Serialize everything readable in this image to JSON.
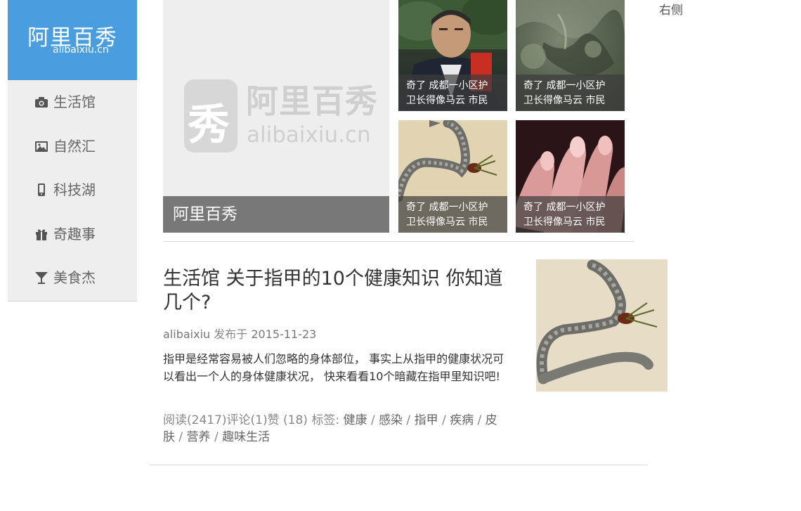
{
  "logo": {
    "text_cn": "阿里百秀",
    "text_en": "alibaixiu.cn"
  },
  "nav": [
    {
      "label": "生活馆",
      "icon": "camera-icon"
    },
    {
      "label": "自然汇",
      "icon": "picture-icon"
    },
    {
      "label": "科技湖",
      "icon": "phone-icon"
    },
    {
      "label": "奇趣事",
      "icon": "gift-icon"
    },
    {
      "label": "美食杰",
      "icon": "cocktail-glass-icon"
    }
  ],
  "featured": {
    "caption": "阿里百秀",
    "watermark_glyph": "秀",
    "watermark_cn": "阿里百秀",
    "watermark_en": "alibaixiu.cn"
  },
  "thumbs": [
    {
      "caption": "奇了 成都一小区护\n卫长得像马云 市民"
    },
    {
      "caption": "奇了 成都一小区护\n卫长得像马云 市民"
    },
    {
      "caption": "奇了 成都一小区护\n卫长得像马云 市民"
    },
    {
      "caption": "奇了 成都一小区护\n卫长得像马云 市民"
    }
  ],
  "article": {
    "title": "生活馆 关于指甲的10个健康知识 你知道几个?",
    "author": "alibaixiu",
    "published_label": "发布于",
    "date": "2015-11-23",
    "excerpt": "指甲是经常容易被人们忽略的身体部位， 事实上从指甲的健康状况可以看出一个人的身体健康状况， 快来看看10个暗藏在指甲里知识吧!",
    "read_label": "阅读",
    "read_count": "(2417)",
    "comment_label": "评论",
    "comment_count": "(1)",
    "like_label": "赞",
    "like_count": "(18)",
    "tags_label": "标签:",
    "tags": [
      "健康",
      "感染",
      "指甲",
      "疾病",
      "皮肤",
      "营养",
      "趣味生活"
    ]
  },
  "right_column_label": "右侧"
}
